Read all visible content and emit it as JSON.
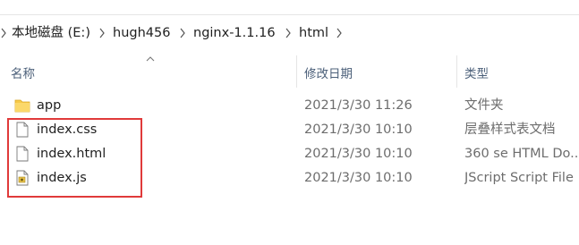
{
  "breadcrumb": {
    "items": [
      {
        "label": "本地磁盘 (E:)"
      },
      {
        "label": "hugh456"
      },
      {
        "label": "nginx-1.1.16"
      },
      {
        "label": "html"
      }
    ]
  },
  "columns": {
    "name": "名称",
    "modified": "修改日期",
    "type": "类型"
  },
  "files": [
    {
      "name": "app",
      "modified": "2021/3/30 11:26",
      "type": "文件夹",
      "icon": "folder-icon"
    },
    {
      "name": "index.css",
      "modified": "2021/3/30 10:10",
      "type": "层叠样式表文档",
      "icon": "file-icon"
    },
    {
      "name": "index.html",
      "modified": "2021/3/30 10:10",
      "type": "360 se HTML Do...",
      "icon": "file-icon"
    },
    {
      "name": "index.js",
      "modified": "2021/3/30 10:10",
      "type": "JScript Script File",
      "icon": "script-file-icon"
    }
  ],
  "colors": {
    "highlight_border": "#e03a3a",
    "header_text": "#4c607a",
    "folder": "#f7c948"
  }
}
